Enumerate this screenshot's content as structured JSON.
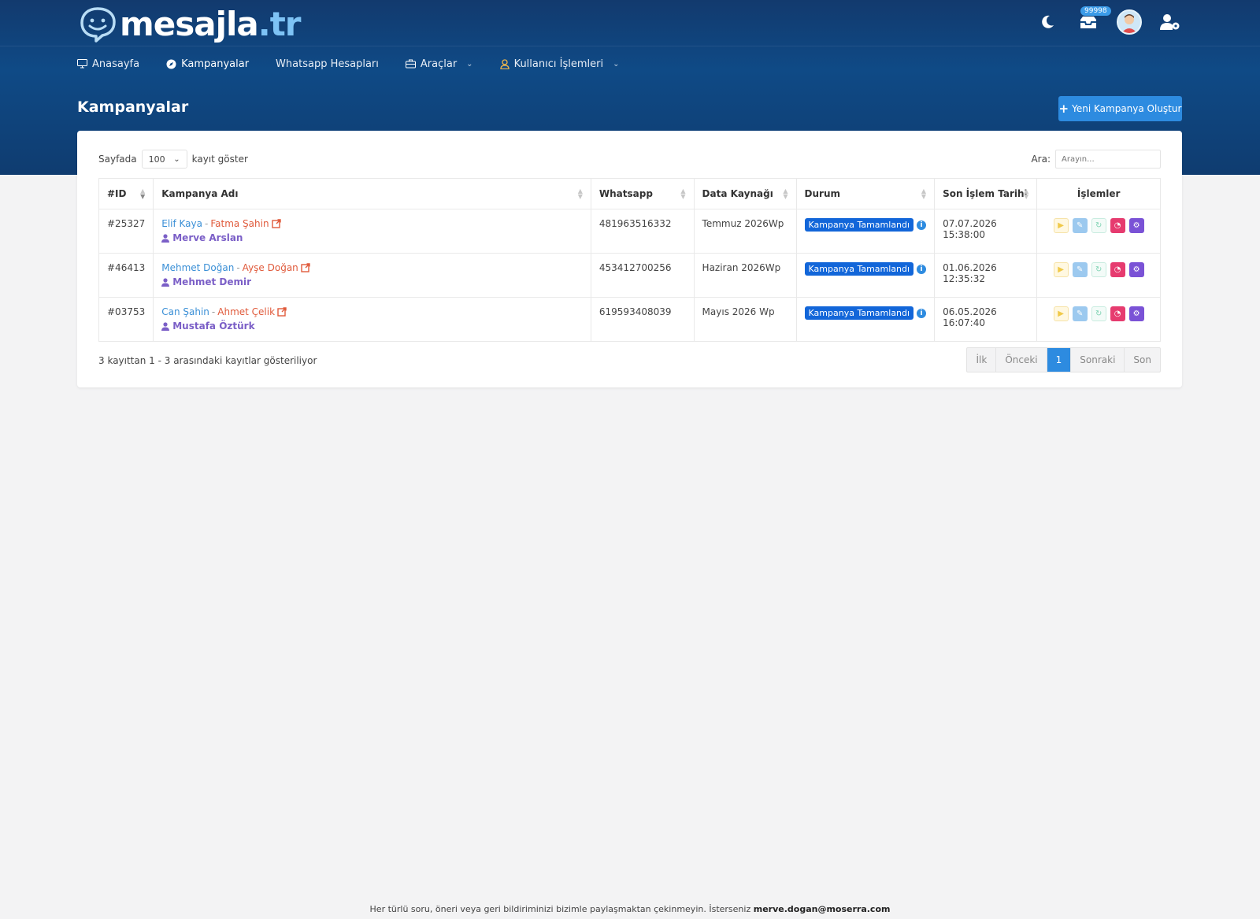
{
  "brand": {
    "name": "mesajla",
    "tld": ".tr"
  },
  "topbar": {
    "notification_count": "99998"
  },
  "nav": {
    "items": [
      {
        "label": "Anasayfa",
        "icon": "monitor-icon"
      },
      {
        "label": "Kampanyalar",
        "icon": "compass-icon"
      },
      {
        "label": "Whatsapp Hesapları",
        "icon": ""
      },
      {
        "label": "Araçlar",
        "icon": "toolbox-icon"
      },
      {
        "label": "Kullanıcı İşlemleri",
        "icon": "user-icon"
      }
    ]
  },
  "page": {
    "title": "Kampanyalar",
    "new_button": "Yeni Kampanya Oluştur"
  },
  "table_controls": {
    "length_prefix": "Sayfada",
    "length_value": "100",
    "length_suffix": "kayıt göster",
    "search_label": "Ara:",
    "search_placeholder": "Arayın..."
  },
  "table": {
    "headers": [
      "#ID",
      "Kampanya Adı",
      "Whatsapp",
      "Data Kaynağı",
      "Durum",
      "Son İşlem Tarihi",
      "İşlemler"
    ],
    "rows": [
      {
        "id": "#25327",
        "name_a": "Elif Kaya",
        "name_b": "Fatma Şahin",
        "owner": "Merve Arslan",
        "whatsapp": "481963516332",
        "source": "Temmuz 2026Wp",
        "status": "Kampanya Tamamlandı",
        "date": "07.07.2026 15:38:00"
      },
      {
        "id": "#46413",
        "name_a": "Mehmet Doğan",
        "name_b": "Ayşe Doğan",
        "owner": "Mehmet Demir",
        "whatsapp": "453412700256",
        "source": "Haziran 2026Wp",
        "status": "Kampanya Tamamlandı",
        "date": "01.06.2026 12:35:32"
      },
      {
        "id": "#03753",
        "name_a": "Can Şahin",
        "name_b": "Ahmet Çelik",
        "owner": "Mustafa Öztürk",
        "whatsapp": "619593408039",
        "source": "Mayıs 2026 Wp",
        "status": "Kampanya Tamamlandı",
        "date": "06.05.2026 16:07:40"
      }
    ]
  },
  "summary": "3 kayıttan 1 - 3 arasındaki kayıtlar gösteriliyor",
  "pagination": {
    "first": "İlk",
    "prev": "Önceki",
    "current": "1",
    "next": "Sonraki",
    "last": "Son"
  },
  "footer": {
    "text": "Her türlü soru, öneri veya geri bildiriminizi bizimle paylaşmaktan çekinmeyin. İsterseniz",
    "email": "merve.dogan@moserra.com"
  },
  "colors": {
    "header_dark": "#123a6e",
    "accent": "#2d8be0",
    "status_badge": "#1266d9",
    "owner_purple": "#7b5fc7",
    "link_blue": "#3a8fd6",
    "link_red": "#e05a3b"
  }
}
